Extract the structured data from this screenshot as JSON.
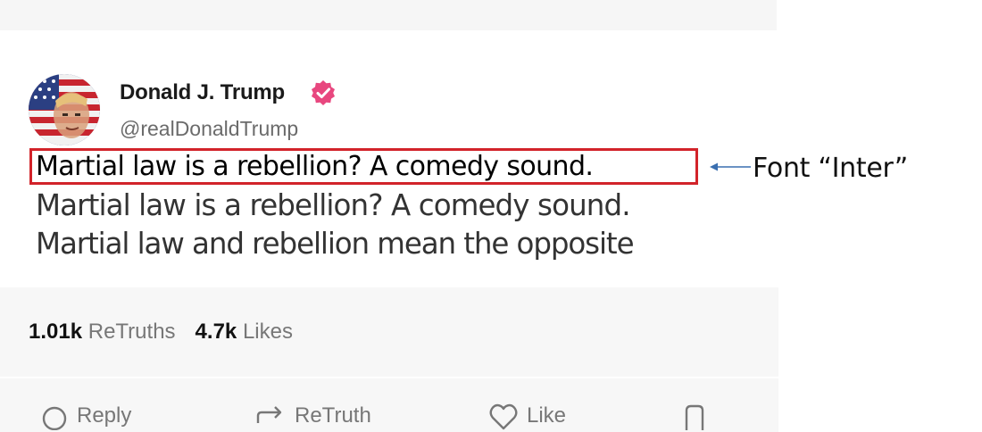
{
  "post": {
    "author": {
      "name": "Donald J. Trump",
      "handle": "@realDonaldTrump",
      "verified": true,
      "verified_color": "#e8477f"
    },
    "lines": [
      "Martial law is a rebellion? A comedy sound.",
      "Martial law is a rebellion?  A comedy sound.",
      "Martial law and rebellion mean the opposite"
    ],
    "stats": {
      "retruths_count": "1.01k",
      "retruths_label": "ReTruths",
      "likes_count": "4.7k",
      "likes_label": "Likes"
    },
    "actions": {
      "reply": "Reply",
      "retruth": "ReTruth",
      "like": "Like"
    }
  },
  "annotation": {
    "text": "Font “Inter”",
    "box_color": "#d2232a",
    "arrow_color": "#3a6fb0"
  }
}
